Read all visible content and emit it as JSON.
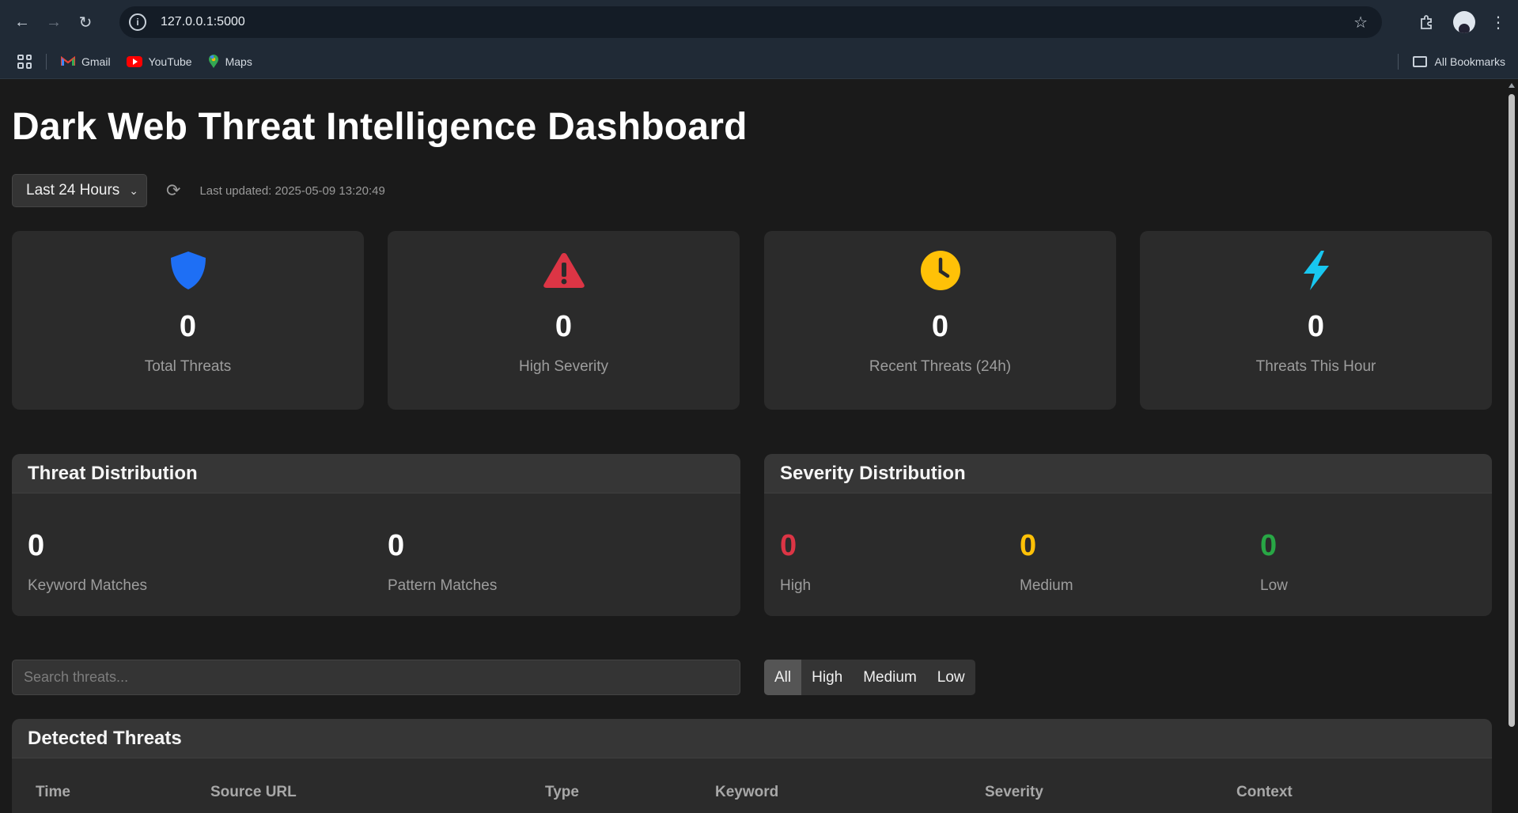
{
  "browser": {
    "url": "127.0.0.1:5000",
    "bookmarks": [
      {
        "label": "Gmail"
      },
      {
        "label": "YouTube"
      },
      {
        "label": "Maps"
      }
    ],
    "all_bookmarks_label": "All Bookmarks"
  },
  "page": {
    "title": "Dark Web Threat Intelligence Dashboard",
    "time_range": {
      "selected": "Last 24 Hours"
    },
    "last_updated": "Last updated: 2025-05-09 13:20:49"
  },
  "stats": [
    {
      "value": "0",
      "label": "Total Threats",
      "icon": "shield-icon",
      "color": "#1e6ff5"
    },
    {
      "value": "0",
      "label": "High Severity",
      "icon": "warning-triangle-icon",
      "color": "#dc3545"
    },
    {
      "value": "0",
      "label": "Recent Threats (24h)",
      "icon": "clock-icon",
      "color": "#ffc107"
    },
    {
      "value": "0",
      "label": "Threats This Hour",
      "icon": "lightning-bolt-icon",
      "color": "#18c7f0"
    }
  ],
  "threat_distribution": {
    "title": "Threat Distribution",
    "items": [
      {
        "value": "0",
        "label": "Keyword Matches"
      },
      {
        "value": "0",
        "label": "Pattern Matches"
      }
    ]
  },
  "severity_distribution": {
    "title": "Severity Distribution",
    "items": [
      {
        "value": "0",
        "label": "High",
        "color": "#dc3545"
      },
      {
        "value": "0",
        "label": "Medium",
        "color": "#ffc107"
      },
      {
        "value": "0",
        "label": "Low",
        "color": "#28a745"
      }
    ]
  },
  "filters": {
    "search_placeholder": "Search threats...",
    "severity_buttons": [
      "All",
      "High",
      "Medium",
      "Low"
    ],
    "active": "All"
  },
  "threats_table": {
    "title": "Detected Threats",
    "columns": [
      "Time",
      "Source URL",
      "Type",
      "Keyword",
      "Severity",
      "Context"
    ]
  }
}
